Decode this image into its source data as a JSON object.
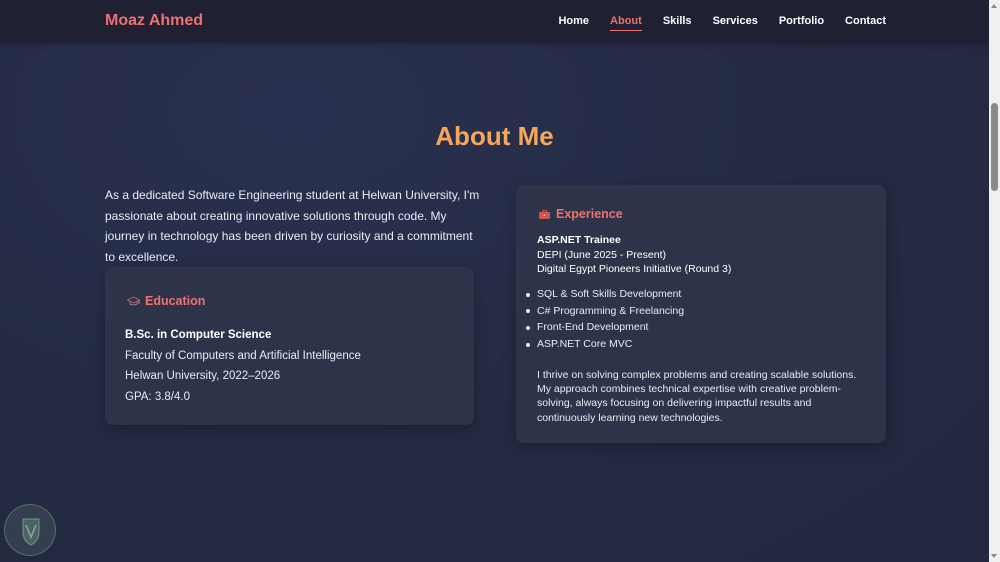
{
  "header": {
    "brand": "Moaz Ahmed",
    "nav": [
      {
        "label": "Home",
        "active": false
      },
      {
        "label": "About",
        "active": true
      },
      {
        "label": "Skills",
        "active": false
      },
      {
        "label": "Services",
        "active": false
      },
      {
        "label": "Portfolio",
        "active": false
      },
      {
        "label": "Contact",
        "active": false
      }
    ]
  },
  "about": {
    "title": "About Me",
    "intro": "As a dedicated Software Engineering student at Helwan University, I'm passionate about creating innovative solutions through code. My journey in technology has been driven by curiosity and a commitment to excellence.",
    "education": {
      "icon": "graduation-icon",
      "title": "Education",
      "degree": "B.Sc. in Computer Science",
      "faculty": "Faculty of Computers and Artificial Intelligence",
      "university": "Helwan University, 2022–2026",
      "gpa": "GPA: 3.8/4.0"
    },
    "experience": {
      "icon": "briefcase-icon",
      "title": "Experience",
      "role": "ASP.NET Trainee",
      "period": "DEPI (June 2025 - Present)",
      "program": "Digital Egypt Pioneers Initiative (Round 3)",
      "items": [
        "SQL & Soft Skills Development",
        "C# Programming & Freelancing",
        "Front-End Development",
        "ASP.NET Core MVC"
      ],
      "description": "I thrive on solving complex problems and creating scalable solutions. My approach combines technical expertise with creative problem-solving, always focusing on delivering impactful results and continuously learning new technologies."
    }
  },
  "colors": {
    "accent": "#f07070",
    "title": "#f5a65b",
    "background": "#242b42",
    "card": "#2d3449",
    "navbar": "#1f2032"
  }
}
